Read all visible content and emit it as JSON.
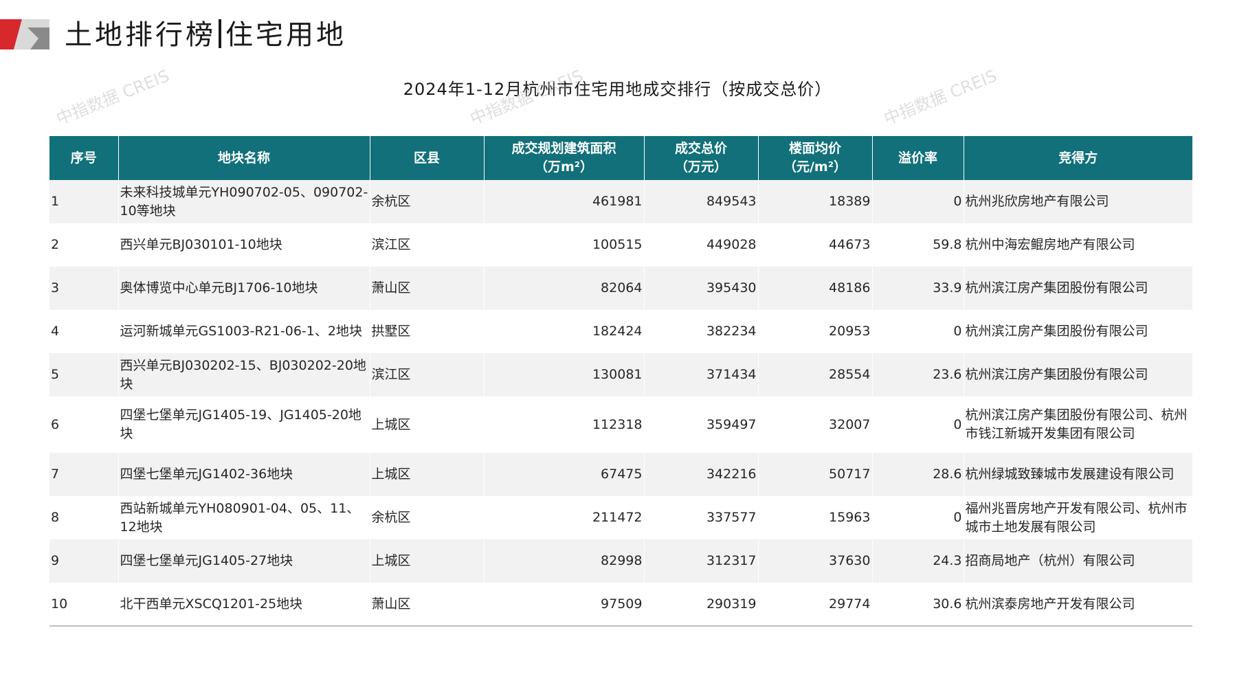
{
  "header": {
    "title_main": "土地排行榜",
    "title_sub": "住宅用地"
  },
  "table": {
    "title": "2024年1-12月杭州市住宅用地成交排行（按成交总价）",
    "columns": [
      {
        "line1": "序号",
        "line2": ""
      },
      {
        "line1": "地块名称",
        "line2": ""
      },
      {
        "line1": "区县",
        "line2": ""
      },
      {
        "line1": "成交规划建筑面积",
        "line2": "（万m²）"
      },
      {
        "line1": "成交总价",
        "line2": "（万元）"
      },
      {
        "line1": "楼面均价",
        "line2": "（元/m²）"
      },
      {
        "line1": "溢价率",
        "line2": ""
      },
      {
        "line1": "竞得方",
        "line2": ""
      }
    ],
    "rows": [
      {
        "rank": "1",
        "name": "未来科技城单元YH090702-05、090702-10等地块",
        "district": "余杭区",
        "area": "461981",
        "price": "849543",
        "unit_price": "18389",
        "premium": "0",
        "winner": "杭州兆欣房地产有限公司"
      },
      {
        "rank": "2",
        "name": "西兴单元BJ030101-10地块",
        "district": "滨江区",
        "area": "100515",
        "price": "449028",
        "unit_price": "44673",
        "premium": "59.8",
        "winner": "杭州中海宏鲲房地产有限公司"
      },
      {
        "rank": "3",
        "name": "奥体博览中心单元BJ1706-10地块",
        "district": "萧山区",
        "area": "82064",
        "price": "395430",
        "unit_price": "48186",
        "premium": "33.9",
        "winner": "杭州滨江房产集团股份有限公司"
      },
      {
        "rank": "4",
        "name": "运河新城单元GS1003-R21-06-1、2地块",
        "district": "拱墅区",
        "area": "182424",
        "price": "382234",
        "unit_price": "20953",
        "premium": "0",
        "winner": "杭州滨江房产集团股份有限公司"
      },
      {
        "rank": "5",
        "name": "西兴单元BJ030202-15、BJ030202-20地块",
        "district": "滨江区",
        "area": "130081",
        "price": "371434",
        "unit_price": "28554",
        "premium": "23.6",
        "winner": "杭州滨江房产集团股份有限公司"
      },
      {
        "rank": "6",
        "name": "四堡七堡单元JG1405-19、JG1405-20地块",
        "district": "上城区",
        "area": "112318",
        "price": "359497",
        "unit_price": "32007",
        "premium": "0",
        "winner": "杭州滨江房产集团股份有限公司、杭州市钱江新城开发集团有限公司"
      },
      {
        "rank": "7",
        "name": "四堡七堡单元JG1402-36地块",
        "district": "上城区",
        "area": "67475",
        "price": "342216",
        "unit_price": "50717",
        "premium": "28.6",
        "winner": "杭州绿城致臻城市发展建设有限公司"
      },
      {
        "rank": "8",
        "name": "西站新城单元YH080901-04、05、11、12地块",
        "district": "余杭区",
        "area": "211472",
        "price": "337577",
        "unit_price": "15963",
        "premium": "0",
        "winner": "福州兆晋房地产开发有限公司、杭州市城市土地发展有限公司"
      },
      {
        "rank": "9",
        "name": "四堡七堡单元JG1405-27地块",
        "district": "上城区",
        "area": "82998",
        "price": "312317",
        "unit_price": "37630",
        "premium": "24.3",
        "winner": "招商局地产（杭州）有限公司"
      },
      {
        "rank": "10",
        "name": "北干西单元XSCQ1201-25地块",
        "district": "萧山区",
        "area": "97509",
        "price": "290319",
        "unit_price": "29774",
        "premium": "30.6",
        "winner": "杭州滨泰房地产开发有限公司"
      }
    ]
  },
  "watermark": {
    "text": "中指数据 CREIS"
  },
  "colors": {
    "header_bg": "#11707a",
    "price_text": "#c0201e",
    "logo_red": "#d7282c",
    "logo_gray": "#9e9e9e"
  }
}
